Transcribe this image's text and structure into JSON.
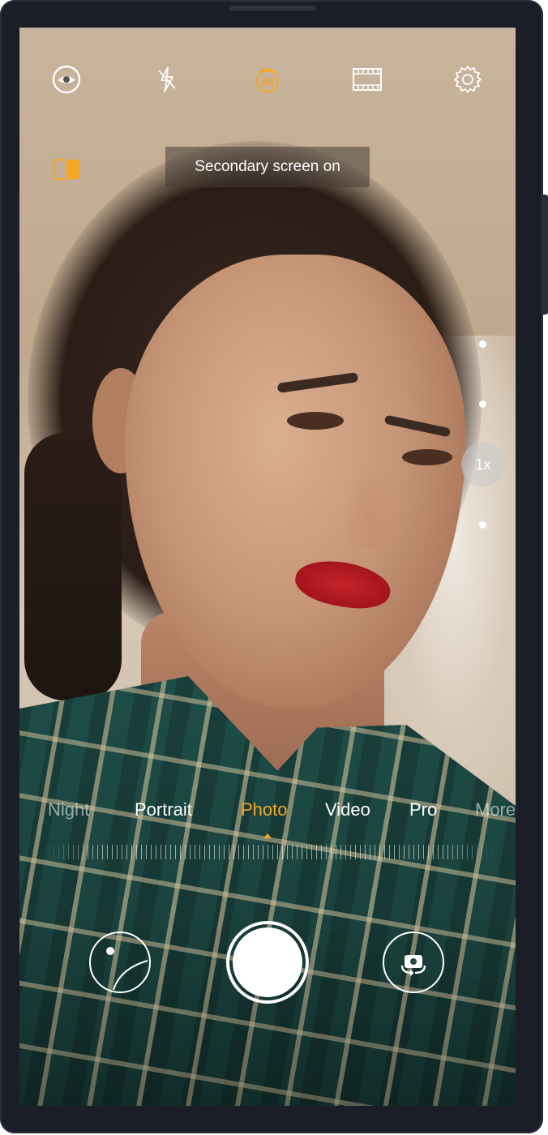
{
  "top_bar": {
    "icons": [
      "hdr-eye-icon",
      "flash-off-icon",
      "ai-icon",
      "film-icon",
      "settings-gear-icon"
    ],
    "ai_label": "AI"
  },
  "secondary_screen": {
    "icon": "dual-screen-icon",
    "toast": "Secondary screen on"
  },
  "zoom": {
    "label": "1x"
  },
  "modes": {
    "items": [
      "Night",
      "Portrait",
      "Photo",
      "Video",
      "Pro",
      "More"
    ],
    "active": "Photo"
  },
  "controls": {
    "gallery": "gallery-thumbnail-icon",
    "shutter": "shutter-button",
    "switch": "switch-camera-icon"
  },
  "colors": {
    "accent": "#f5a623",
    "frame": "#1b1e27",
    "white": "#ffffff"
  }
}
